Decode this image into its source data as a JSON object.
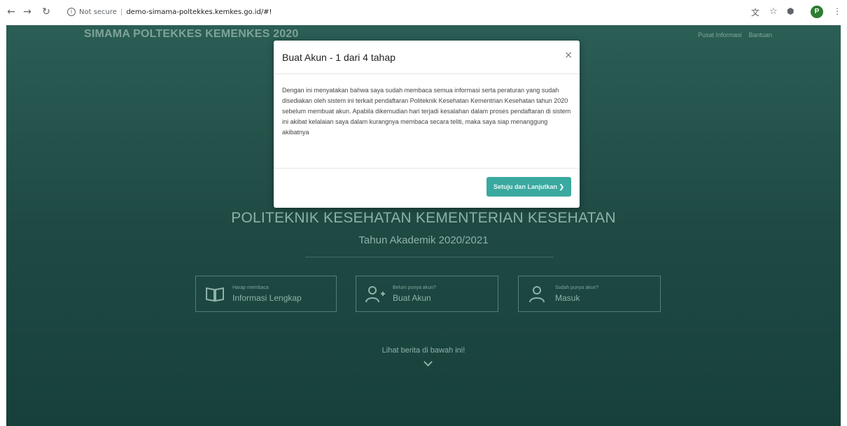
{
  "browser": {
    "nav": {
      "back": "←",
      "forward": "→",
      "reload": "↻"
    },
    "security_label": "Not secure",
    "url": "demo-simama-poltekkes.kemkes.go.id/#!",
    "right_icons": [
      "translate-icon",
      "star-icon",
      "extension-icon"
    ],
    "profile_initial": "P"
  },
  "header": {
    "title": "SIMAMA POLTEKKES KEMENKES 2020",
    "links": [
      "Pusat Informasi",
      "Bantuan"
    ]
  },
  "hero": {
    "title": "POLITEKNIK KESEHATAN KEMENTERIAN KESEHATAN",
    "subtitle": "Tahun Akademik 2020/2021"
  },
  "actions": [
    {
      "small": "Harap membaca",
      "big": "Informasi Lengkap",
      "icon": "book-icon"
    },
    {
      "small": "Belum punya akun?",
      "big": "Buat Akun",
      "icon": "user-plus-icon"
    },
    {
      "small": "Sudah punya akun?",
      "big": "Masuk",
      "icon": "user-icon"
    }
  ],
  "news": {
    "label": "Lihat berita di bawah ini!"
  },
  "modal": {
    "title": "Buat Akun - 1 dari 4 tahap",
    "close": "×",
    "body": "Dengan ini menyatakan bahwa saya sudah membaca semua informasi serta peraturan yang sudah disediakan oleh sistem ini terkait pendaftaran Politeknik Kesehatan Kementrian Kesehatan tahun 2020 sebelum membuat akun. Apabila dikemudian hari terjadi kesalahan dalam proses pendaftaran di sistem ini akibat kelalaian saya dalam kurangnya membaca secara teliti, maka saya siap menanggung akibatnya",
    "button": "Setuju dan Lanjutkan ❯"
  },
  "colors": {
    "page_bg": "#23524b",
    "accent": "#3aa9a0"
  }
}
